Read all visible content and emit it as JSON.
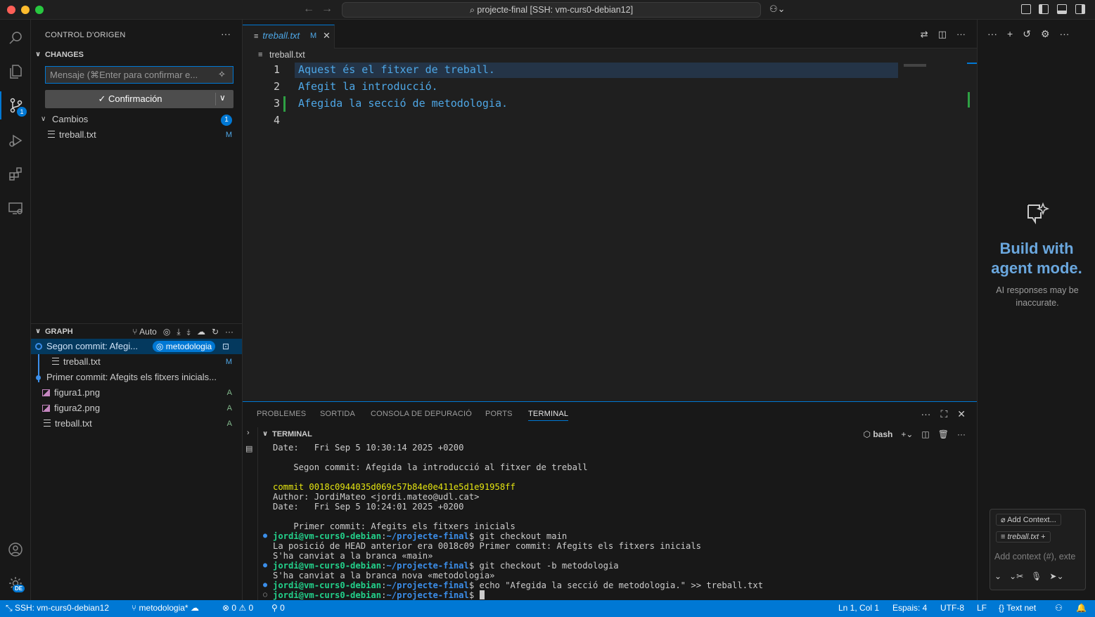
{
  "window": {
    "title": "projecte-final [SSH: vm-curs0-debian12]"
  },
  "activity_bar": {
    "scm_badge": "1",
    "accounts_badge": "DE"
  },
  "sidebar": {
    "title": "CONTROL D'ORIGEN",
    "changes_header": "CHANGES",
    "message_placeholder": "Mensaje (⌘Enter para confirmar e...",
    "commit_button": "✓ Confirmación",
    "changes_group": {
      "label": "Cambios",
      "count": "1",
      "files": [
        {
          "name": "treball.txt",
          "status": "M"
        }
      ]
    },
    "graph": {
      "header": "GRAPH",
      "auto_label": "Auto",
      "commits": [
        {
          "message": "Segon commit: Afegi...",
          "branch": "◎ metodologia",
          "files": [
            {
              "name": "treball.txt",
              "status": "M"
            }
          ]
        },
        {
          "message": "Primer commit: Afegits els fitxers inicials...",
          "files": [
            {
              "name": "figura1.png",
              "status": "A"
            },
            {
              "name": "figura2.png",
              "status": "A"
            },
            {
              "name": "treball.txt",
              "status": "A"
            }
          ]
        }
      ]
    }
  },
  "editor": {
    "tab": {
      "label": "treball.txt",
      "status": "M"
    },
    "breadcrumb": "treball.txt",
    "lines": [
      {
        "num": "1",
        "text": "Aquest és el fitxer de treball."
      },
      {
        "num": "2",
        "text": "Afegit la introducció."
      },
      {
        "num": "3",
        "text": "Afegida la secció de metodologia."
      },
      {
        "num": "4",
        "text": ""
      }
    ]
  },
  "panel": {
    "tabs": [
      "PROBLEMES",
      "SORTIDA",
      "CONSOLA DE DEPURACIÓ",
      "PORTS",
      "TERMINAL"
    ],
    "active_tab": "TERMINAL",
    "terminal_header": "TERMINAL",
    "shell": "bash",
    "terminal": {
      "l1": "Date:   Fri Sep 5 10:30:14 2025 +0200",
      "l2": "    Segon commit: Afegida la introducció al fitxer de treball",
      "l3": "commit 0018c0944035d069c57b84e0e411e5d1e91958ff",
      "l4": "Author: JordiMateo <jordi.mateo@udl.cat>",
      "l5": "Date:   Fri Sep 5 10:24:01 2025 +0200",
      "l6": "    Primer commit: Afegits els fitxers inicials",
      "prompt_user": "jordi@vm-curs0-debian",
      "prompt_path": "~/projecte-final",
      "cmd1": "$ git checkout main",
      "l7": "La posició de HEAD anterior era 0018c09 Primer commit: Afegits els fitxers inicials",
      "l8": "S'ha canviat a la branca «main»",
      "cmd2": "$ git checkout -b metodologia",
      "l9": "S'ha canviat a la branca nova «metodologia»",
      "cmd3": "$ echo \"Afegida la secció de metodologia.\" >> treball.txt",
      "cmd4": "$ "
    }
  },
  "chat": {
    "title": "Build with agent mode.",
    "subtitle": "AI responses may be inaccurate.",
    "add_context": "Add Context...",
    "context_file": "treball.txt",
    "input_placeholder": "Add context (#), exte"
  },
  "status_bar": {
    "remote": "SSH: vm-curs0-debian12",
    "branch": "metodologia*",
    "errors": "0",
    "warnings": "0",
    "ports": "0",
    "position": "Ln 1, Col 1",
    "spaces": "Espais: 4",
    "encoding": "UTF-8",
    "eol": "LF",
    "language": "Text net"
  },
  "colors": {
    "accent": "#0078d4",
    "modified": "#4ea7e6",
    "added": "#81b88b"
  }
}
